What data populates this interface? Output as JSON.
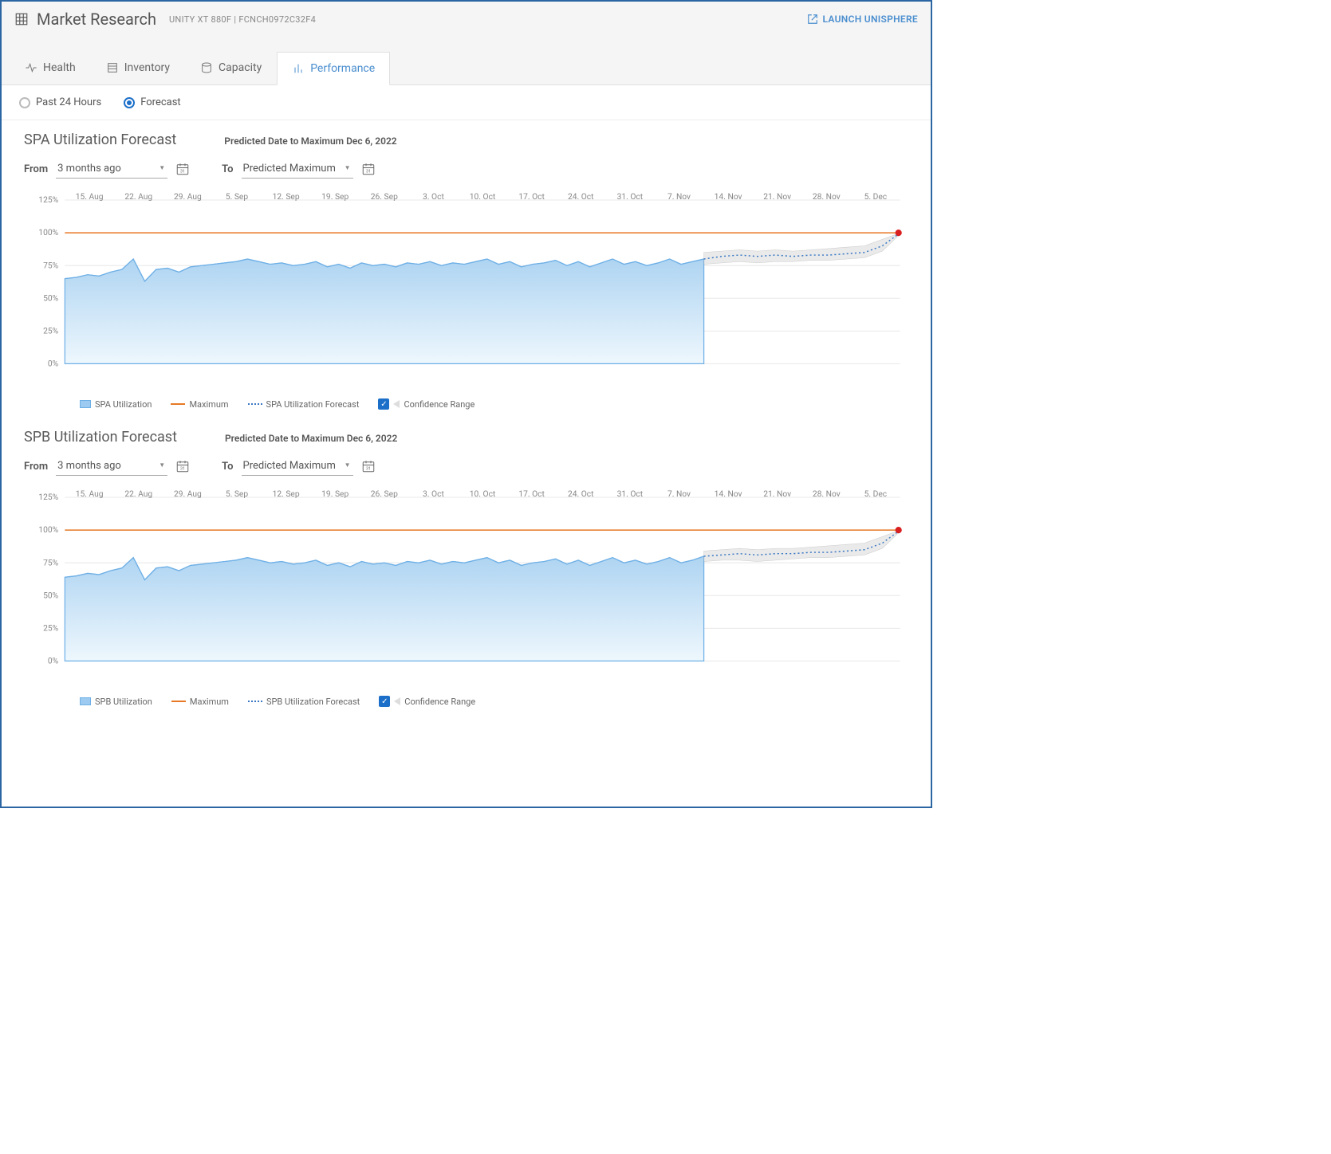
{
  "header": {
    "title": "Market Research",
    "subtitle": "UNITY XT 880F | FCNCH0972C32F4",
    "launch_label": "LAUNCH UNISPHERE"
  },
  "tabs": [
    {
      "id": "health",
      "label": "Health",
      "active": false
    },
    {
      "id": "inventory",
      "label": "Inventory",
      "active": false
    },
    {
      "id": "capacity",
      "label": "Capacity",
      "active": false
    },
    {
      "id": "performance",
      "label": "Performance",
      "active": true
    }
  ],
  "radios": {
    "past24_label": "Past 24 Hours",
    "forecast_label": "Forecast",
    "selected": "forecast"
  },
  "range": {
    "from_label": "From",
    "to_label": "To",
    "from_value": "3 months ago",
    "to_value": "Predicted Maximum"
  },
  "sections": [
    {
      "key": "spa",
      "title": "SPA Utilization Forecast",
      "predict": "Predicted Date to Maximum Dec 6, 2022",
      "legend": [
        "SPA Utilization",
        "Maximum",
        "SPA Utilization Forecast",
        "Confidence Range"
      ]
    },
    {
      "key": "spb",
      "title": "SPB Utilization Forecast",
      "predict": "Predicted Date to Maximum Dec 6, 2022",
      "legend": [
        "SPB Utilization",
        "Maximum",
        "SPB Utilization Forecast",
        "Confidence Range"
      ]
    }
  ],
  "chart_data": [
    {
      "type": "area",
      "title": "SPA Utilization Forecast",
      "ylabel": "%",
      "ylim": [
        0,
        125
      ],
      "yticks": [
        0,
        25,
        50,
        75,
        100,
        125
      ],
      "xticks": [
        "15. Aug",
        "22. Aug",
        "29. Aug",
        "5. Sep",
        "12. Sep",
        "19. Sep",
        "26. Sep",
        "3. Oct",
        "10. Oct",
        "17. Oct",
        "24. Oct",
        "31. Oct",
        "7. Nov",
        "14. Nov",
        "21. Nov",
        "28. Nov",
        "5. Dec"
      ],
      "series": [
        {
          "name": "SPA Utilization",
          "kind": "area",
          "x_start": "10. Aug",
          "x_end": "9. Nov",
          "values": [
            65,
            66,
            68,
            67,
            70,
            72,
            80,
            63,
            72,
            73,
            70,
            74,
            75,
            76,
            77,
            78,
            80,
            78,
            76,
            77,
            75,
            76,
            78,
            74,
            76,
            73,
            77,
            75,
            76,
            74,
            77,
            76,
            78,
            75,
            77,
            76,
            78,
            80,
            76,
            78,
            74,
            76,
            77,
            79,
            75,
            78,
            74,
            77,
            80,
            76,
            78,
            75,
            77,
            80,
            76,
            78,
            80
          ]
        },
        {
          "name": "Maximum",
          "kind": "hline",
          "value": 100
        },
        {
          "name": "SPA Utilization Forecast",
          "kind": "dotted",
          "x_start": "9. Nov",
          "x_end": "6. Dec",
          "values": [
            80,
            82,
            83,
            82,
            83,
            82,
            83,
            83,
            84,
            85,
            90,
            100
          ]
        },
        {
          "name": "Confidence Range",
          "kind": "band",
          "x_start": "9. Nov",
          "x_end": "6. Dec",
          "upper": [
            85,
            86,
            87,
            86,
            87,
            86,
            87,
            88,
            89,
            90,
            95,
            100
          ],
          "lower": [
            76,
            77,
            78,
            77,
            78,
            78,
            79,
            79,
            80,
            81,
            86,
            99
          ]
        }
      ],
      "end_marker": {
        "x": "6. Dec",
        "y": 100
      }
    },
    {
      "type": "area",
      "title": "SPB Utilization Forecast",
      "ylabel": "%",
      "ylim": [
        0,
        125
      ],
      "yticks": [
        0,
        25,
        50,
        75,
        100,
        125
      ],
      "xticks": [
        "15. Aug",
        "22. Aug",
        "29. Aug",
        "5. Sep",
        "12. Sep",
        "19. Sep",
        "26. Sep",
        "3. Oct",
        "10. Oct",
        "17. Oct",
        "24. Oct",
        "31. Oct",
        "7. Nov",
        "14. Nov",
        "21. Nov",
        "28. Nov",
        "5. Dec"
      ],
      "series": [
        {
          "name": "SPB Utilization",
          "kind": "area",
          "x_start": "10. Aug",
          "x_end": "9. Nov",
          "values": [
            64,
            65,
            67,
            66,
            69,
            71,
            79,
            62,
            71,
            72,
            69,
            73,
            74,
            75,
            76,
            77,
            79,
            77,
            75,
            76,
            74,
            75,
            77,
            73,
            75,
            72,
            76,
            74,
            75,
            73,
            76,
            75,
            77,
            74,
            76,
            75,
            77,
            79,
            75,
            77,
            73,
            75,
            76,
            78,
            74,
            77,
            73,
            76,
            79,
            75,
            77,
            74,
            76,
            79,
            75,
            77,
            80
          ]
        },
        {
          "name": "Maximum",
          "kind": "hline",
          "value": 100
        },
        {
          "name": "SPB Utilization Forecast",
          "kind": "dotted",
          "x_start": "9. Nov",
          "x_end": "6. Dec",
          "values": [
            80,
            81,
            82,
            81,
            82,
            82,
            83,
            83,
            84,
            85,
            90,
            100
          ]
        },
        {
          "name": "Confidence Range",
          "kind": "band",
          "x_start": "9. Nov",
          "x_end": "6. Dec",
          "upper": [
            84,
            85,
            86,
            85,
            86,
            86,
            87,
            88,
            89,
            90,
            95,
            100
          ],
          "lower": [
            76,
            77,
            77,
            76,
            77,
            78,
            79,
            79,
            80,
            81,
            86,
            99
          ]
        }
      ],
      "end_marker": {
        "x": "6. Dec",
        "y": 100
      }
    }
  ]
}
